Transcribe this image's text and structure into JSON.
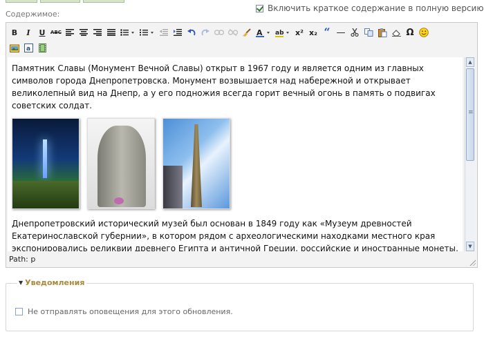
{
  "form": {
    "content_label": "Содержимое:",
    "include_summary_label": "Включить краткое содержание в полную версию",
    "include_summary_checked": true
  },
  "toolbar": {
    "bold": "B",
    "italic": "I",
    "underline": "U",
    "strike": "ABC",
    "superscript": "x²",
    "subscript": "x₂",
    "quote": "“",
    "hr": "—",
    "omega": "Ω",
    "text_color": "A",
    "highlight": "ab"
  },
  "content": {
    "paragraph1": "Памятник Славы (Монумент Вечной Славы) открыт в 1967 году и является одним из главных символов города Днепропетровска. Монумент возвышается над набережной и открывает великолепный вид на Днепр, а у его подножия всегда горит вечный огонь в память о подвигах советских солдат.",
    "paragraph2": "Днепропетровский исторический музей был основан в 1849 году как «Музеум древностей Екатеринославской губернии», в котором рядом с археологическими находками местного края экспонировались реликвии древнего Египта и античной Греции, российские и иностранные монеты, палеонтологические останки и многое другое. Музей является одним из старейших в Украине. У истоков его создания стояли местные деятели - губернатор"
  },
  "status": {
    "path": "Path: p"
  },
  "notifications": {
    "legend": "Уведомления",
    "dont_notify_label": "Не отправлять оповещения для этого обновления.",
    "dont_notify_checked": false
  }
}
